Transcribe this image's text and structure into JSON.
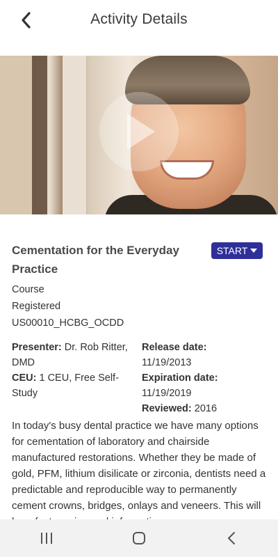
{
  "header": {
    "title": "Activity Details"
  },
  "icons": {
    "back": "chevron-left-icon",
    "play": "play-icon",
    "dropdown": "caret-down-icon"
  },
  "colors": {
    "accent": "#2f2f99",
    "text": "#333333",
    "nav_bg": "#f2f2f2"
  },
  "course": {
    "title": "Cementation for the Everyday Practice",
    "start_label": "START",
    "type": "Course",
    "status": "Registered",
    "code": "US00010_HCBG_OCDD"
  },
  "details": {
    "presenter_label": "Presenter:",
    "presenter_value": "Dr. Rob Ritter, DMD",
    "ceu_label": "CEU:",
    "ceu_value": "1 CEU, Free Self-Study",
    "release_label": "Release date:",
    "release_value": "11/19/2013",
    "expiration_label": "Expiration date:",
    "expiration_value": "11/19/2019",
    "reviewed_label": "Reviewed:",
    "reviewed_value": "2016"
  },
  "description": "In today's busy dental practice we have many options for cementation of laboratory and chairside manufactured restorations. Whether they be made of gold, PFM, lithium disilicate or zirconia, dentists need a predictable and reproducible way to permanently cement crowns, bridges, onlays and veneers. This will be a fast moving and informative",
  "navbar": {
    "recent": "recent-apps-icon",
    "home": "home-icon",
    "back": "back-icon"
  }
}
